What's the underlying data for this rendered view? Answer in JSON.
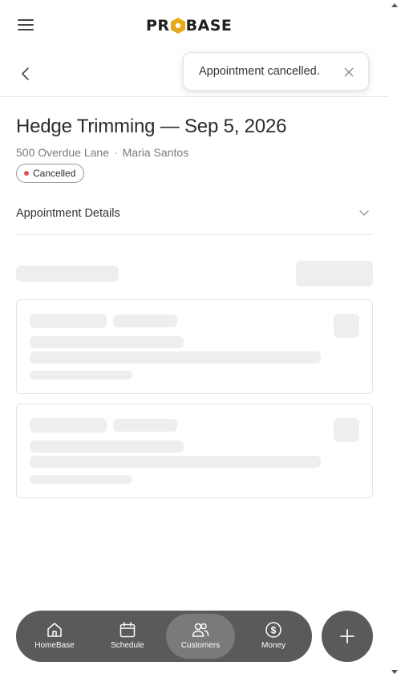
{
  "header": {
    "logo_text": "PROBASE",
    "logo_prefix": "PR",
    "logo_suffix": "BASE",
    "brand_accent": "#e6a817"
  },
  "toast": {
    "message": "Appointment cancelled."
  },
  "appointment": {
    "title": "Hedge Trimming — Sep 5, 2026",
    "address": "500 Overdue Lane",
    "separator": "·",
    "customer": "Maria Santos",
    "status": "Cancelled",
    "status_color": "#e05252"
  },
  "details": {
    "label": "Appointment Details"
  },
  "nav": {
    "items": [
      {
        "label": "HomeBase",
        "icon": "home-icon"
      },
      {
        "label": "Schedule",
        "icon": "calendar-icon"
      },
      {
        "label": "Customers",
        "icon": "users-icon",
        "active": true
      },
      {
        "label": "Money",
        "icon": "dollar-icon"
      }
    ],
    "fab_icon": "plus-icon"
  }
}
